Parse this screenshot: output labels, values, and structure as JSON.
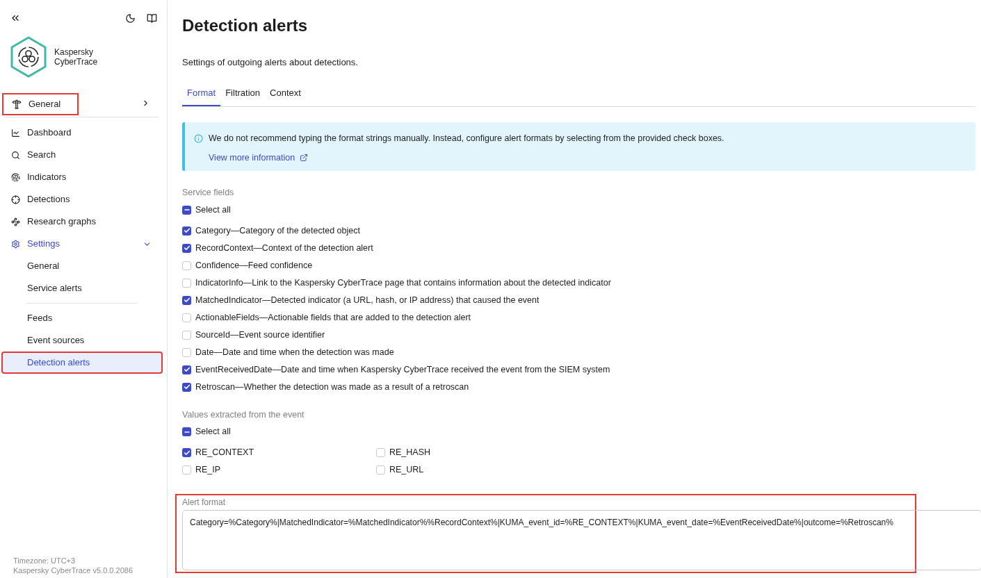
{
  "sidebar": {
    "brand": [
      "Kaspersky",
      "CyberTrace"
    ],
    "top_item": {
      "label": "General",
      "highlighted": true
    },
    "items": [
      {
        "kind": "chart",
        "label": "Dashboard",
        "selected": false
      },
      {
        "kind": "search",
        "label": "Search",
        "selected": false
      },
      {
        "kind": "fingerprint",
        "label": "Indicators",
        "selected": false
      },
      {
        "kind": "crosshair",
        "label": "Detections",
        "selected": false
      },
      {
        "kind": "graph",
        "label": "Research graphs",
        "selected": false
      },
      {
        "kind": "gear",
        "label": "Settings",
        "selected": true,
        "expanded": true,
        "children": [
          {
            "label": "General",
            "selected": false,
            "divider_before": false,
            "highlighted": false
          },
          {
            "label": "Service alerts",
            "selected": false,
            "divider_before": false,
            "highlighted": false
          },
          {
            "label": "Feeds",
            "selected": false,
            "divider_before": true,
            "highlighted": false
          },
          {
            "label": "Event sources",
            "selected": false,
            "divider_before": false,
            "highlighted": false
          },
          {
            "label": "Detection alerts",
            "selected": true,
            "divider_before": false,
            "highlighted": true
          }
        ]
      }
    ],
    "footer": [
      "Timezone: UTC+3",
      "Kaspersky CyberTrace v5.0.0.2086"
    ]
  },
  "page": {
    "title": "Detection alerts",
    "subtitle": "Settings of outgoing alerts about detections.",
    "tabs": [
      {
        "label": "Format",
        "selected": true
      },
      {
        "label": "Filtration",
        "selected": false
      },
      {
        "label": "Context",
        "selected": false
      }
    ],
    "info": {
      "text": "We do not recommend typing the format strings manually. Instead, configure alert formats by selecting from the provided check boxes.",
      "link": "View more information"
    },
    "service_fields": {
      "heading": "Service fields",
      "select_all": {
        "label": "Select all",
        "indeterminate": true
      },
      "items": [
        {
          "label": "Category—Category of the detected object",
          "checked": true
        },
        {
          "label": "RecordContext—Context of the detection alert",
          "checked": true
        },
        {
          "label": "Confidence—Feed confidence",
          "checked": false
        },
        {
          "label": "IndicatorInfo—Link to the Kaspersky CyberTrace page that contains information about the detected indicator",
          "checked": false
        },
        {
          "label": "MatchedIndicator—Detected indicator (a URL, hash, or IP address) that caused the event",
          "checked": true
        },
        {
          "label": "ActionableFields—Actionable fields that are added to the detection alert",
          "checked": false
        },
        {
          "label": "SourceId—Event source identifier",
          "checked": false
        },
        {
          "label": "Date—Date and time when the detection was made",
          "checked": false
        },
        {
          "label": "EventReceivedDate—Date and time when Kaspersky CyberTrace received the event from the SIEM system",
          "checked": true
        },
        {
          "label": "Retroscan—Whether the detection was made as a result of a retroscan",
          "checked": true
        }
      ]
    },
    "event_values": {
      "heading": "Values extracted from the event",
      "select_all": {
        "label": "Select all",
        "indeterminate": true
      },
      "items": [
        {
          "label": "RE_CONTEXT",
          "checked": true
        },
        {
          "label": "RE_HASH",
          "checked": false
        },
        {
          "label": "RE_IP",
          "checked": false
        },
        {
          "label": "RE_URL",
          "checked": false
        }
      ]
    },
    "alert_format": {
      "label": "Alert format",
      "value": "Category=%Category%|MatchedIndicator=%MatchedIndicator%%RecordContext%|KUMA_event_id=%RE_CONTEXT%|KUMA_event_date=%EventReceivedDate%|outcome=%Retroscan%",
      "highlighted": true
    }
  }
}
